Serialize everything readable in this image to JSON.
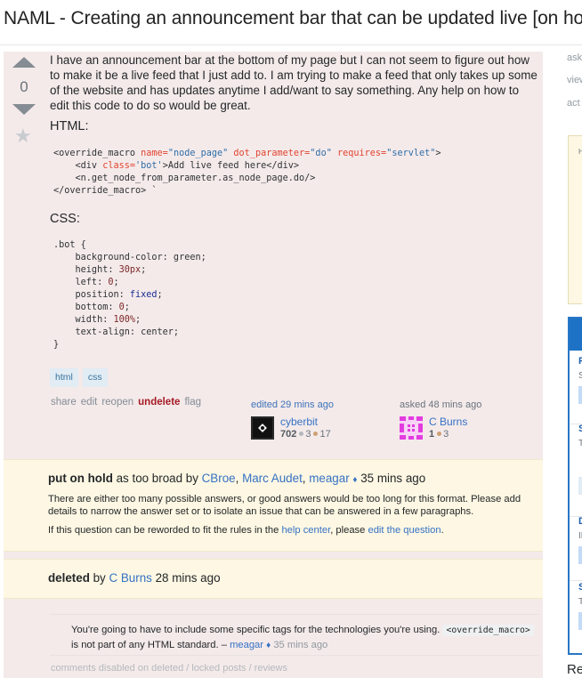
{
  "page": {
    "title": "NAML - Creating an announcement bar that can be updated live [on hold]"
  },
  "question": {
    "vote_count": "0",
    "body": "I have an announcement bar at the bottom of my page but I can not seem to figure out how to make it be a live feed that I just add to. I am trying to make a feed that only takes up some of the website and has updates anytime I add/want to say something. Any help on how to edit this code to do so would be great.",
    "html_label": "HTML:",
    "css_label": "CSS:",
    "html_code": {
      "line1": {
        "open": "<override_macro ",
        "a1": "name=",
        "v1": "\"node_page\"",
        "a2": " dot_parameter=",
        "v2": "\"do\"",
        "a3": " requires=",
        "v3": "\"servlet\"",
        "close": ">"
      },
      "line2": {
        "open": "    <div ",
        "a1": "class=",
        "v1": "'bot'",
        "close": ">Add live feed here</div>"
      },
      "line3": "    <n.get_node_from_parameter.as_node_page.do/>",
      "line4": "</override_macro> `"
    },
    "css_code": {
      "selector": ".bot {",
      "l1": "    background-color: green;",
      "l2_prop": "    height: ",
      "l2_val": "30px",
      "l2_end": ";",
      "l3_prop": "    left: ",
      "l3_val": "0",
      "l3_end": ";",
      "l4_prop": "    position: ",
      "l4_val": "fixed",
      "l4_end": ";",
      "l5_prop": "    bottom: ",
      "l5_val": "0",
      "l5_end": ";",
      "l6_prop": "    width: ",
      "l6_val": "100%",
      "l6_end": ";",
      "l7": "    text-align: center;",
      "close": "}"
    },
    "tags": [
      "html",
      "css"
    ],
    "menu": {
      "share": "share",
      "edit": "edit",
      "reopen": "reopen",
      "undelete": "undelete",
      "flag": "flag"
    },
    "edited": {
      "action": "edited 29 mins ago",
      "user": "cyberbit",
      "rep": "702",
      "silver": "3",
      "bronze": "17"
    },
    "asked": {
      "action": "asked 48 mins ago",
      "user": "C Burns",
      "rep": "1",
      "bronze": "3"
    }
  },
  "hold_notice": {
    "status": "put on hold",
    "reason": " as too broad by ",
    "voters": [
      "CBroe",
      "Marc Audet",
      "meagar"
    ],
    "moderator_mark": "♦",
    "time": " 35 mins ago",
    "explanation": "There are either too many possible answers, or good answers would be too long for this format. Please add details to narrow the answer set or to isolate an issue that can be answered in a few paragraphs.",
    "reword_prefix": "If this question can be reworded to fit the rules in the ",
    "help_center_link": "help center",
    "reword_middle": ", please ",
    "edit_link": "edit the question",
    "reword_suffix": "."
  },
  "deleted_notice": {
    "status": "deleted",
    "by": " by ",
    "user": "C Burns",
    "time": " 28 mins ago"
  },
  "comments": [
    {
      "text_before": "You're going to have to include some specific tags for the technologies you're using. ",
      "code": "<override_macro>",
      "text_after": " is not part of any HTML standard. – ",
      "user": "meagar",
      "moderator_mark": "♦",
      "time": " 35 mins ago"
    }
  ],
  "comments_disabled": "comments disabled on deleted / locked posts / reviews",
  "sidebar": {
    "stats": [
      "ask",
      "view",
      "act"
    ],
    "notice_initial": "H",
    "jobs": [
      {
        "title": "F",
        "sub": "S"
      },
      {
        "title": "S",
        "sub": "T"
      },
      {
        "title": "D",
        "sub": "IN"
      },
      {
        "title": "S",
        "sub": "T"
      }
    ],
    "bottom_text": "Re"
  }
}
